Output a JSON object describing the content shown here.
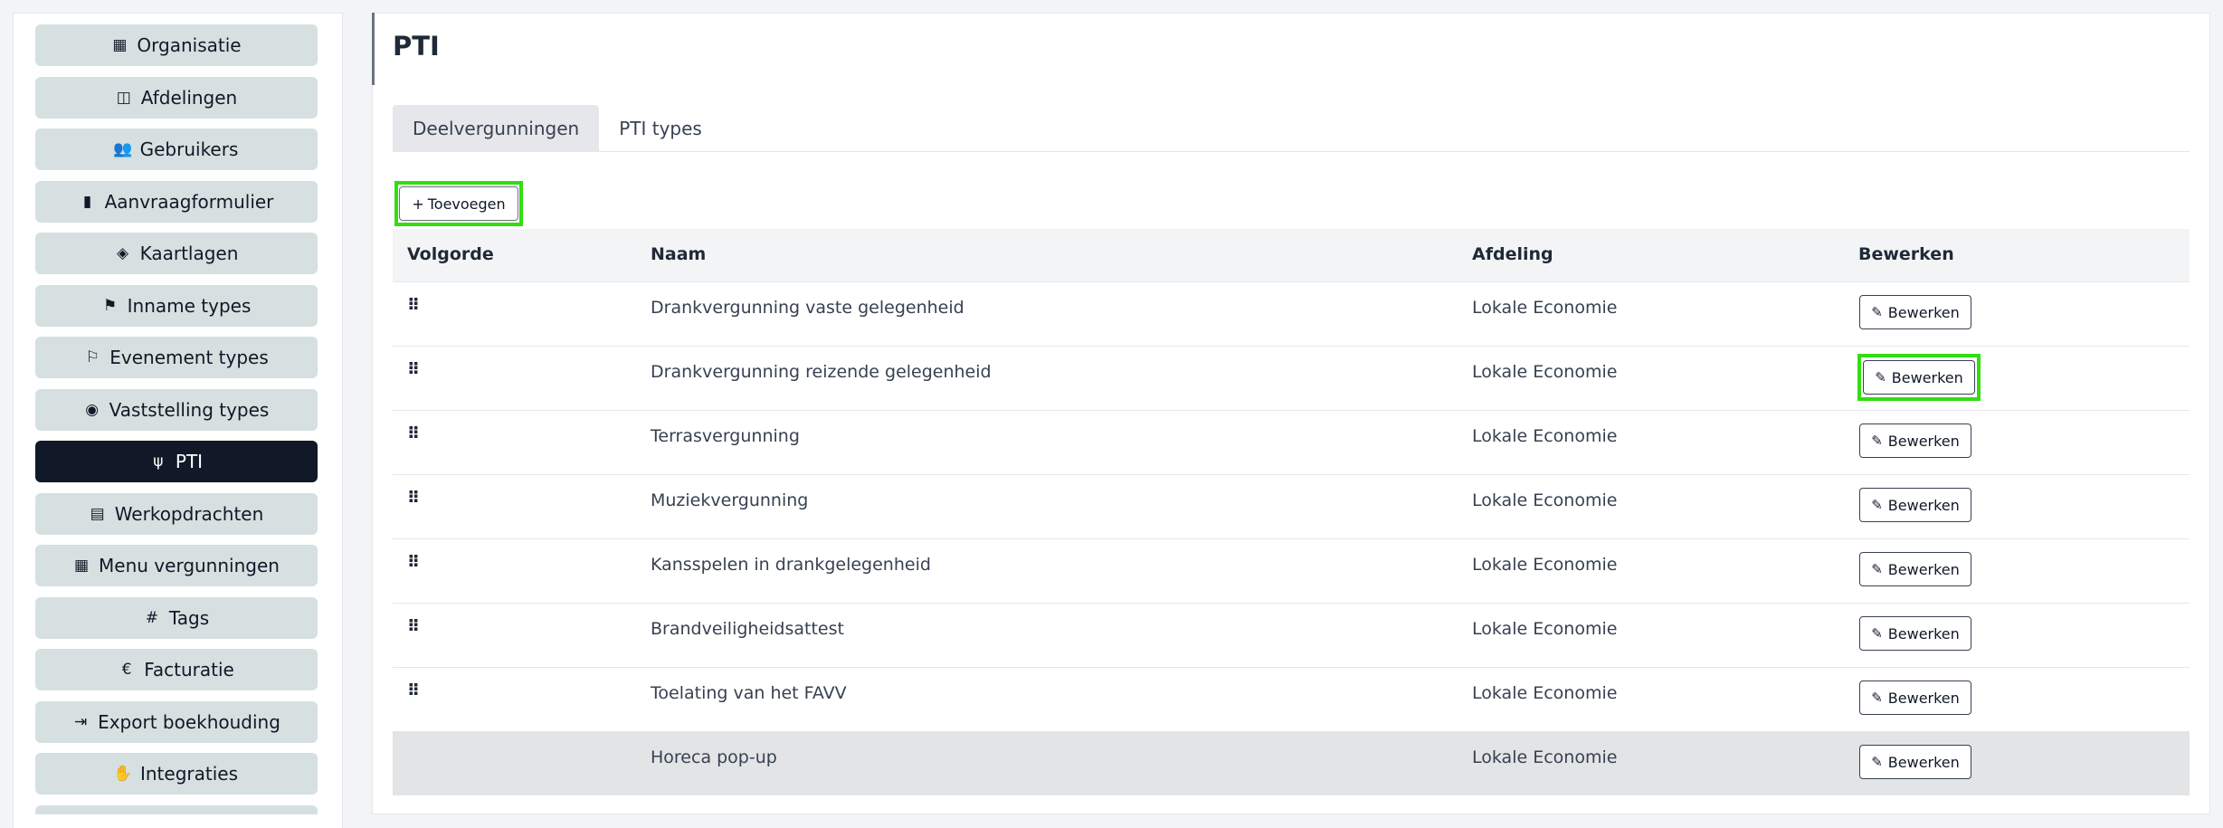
{
  "sidebar": {
    "items": [
      {
        "label": "Organisatie",
        "icon": "building-icon",
        "glyph": "▦",
        "active": false
      },
      {
        "label": "Afdelingen",
        "icon": "table-columns-icon",
        "glyph": "◫",
        "active": false
      },
      {
        "label": "Gebruikers",
        "icon": "users-icon",
        "glyph": "👥",
        "active": false
      },
      {
        "label": "Aanvraagformulier",
        "icon": "clipboard-icon",
        "glyph": "▮",
        "active": false
      },
      {
        "label": "Kaartlagen",
        "icon": "layers-icon",
        "glyph": "◈",
        "active": false
      },
      {
        "label": "Inname types",
        "icon": "signs-post-icon",
        "glyph": "⚑",
        "active": false
      },
      {
        "label": "Evenement types",
        "icon": "flag-checkered-icon",
        "glyph": "⚐",
        "active": false
      },
      {
        "label": "Vaststelling types",
        "icon": "eye-icon",
        "glyph": "◉",
        "active": false
      },
      {
        "label": "PTI",
        "icon": "utensils-icon",
        "glyph": "ψ",
        "active": true
      },
      {
        "label": "Werkopdrachten",
        "icon": "file-icon",
        "glyph": "▤",
        "active": false
      },
      {
        "label": "Menu vergunningen",
        "icon": "table-list-icon",
        "glyph": "▦",
        "active": false
      },
      {
        "label": "Tags",
        "icon": "hashtag-icon",
        "glyph": "#",
        "active": false
      },
      {
        "label": "Facturatie",
        "icon": "euro-icon",
        "glyph": "€",
        "active": false
      },
      {
        "label": "Export boekhouding",
        "icon": "file-export-icon",
        "glyph": "⇥",
        "active": false
      },
      {
        "label": "Integraties",
        "icon": "handshake-icon",
        "glyph": "✋",
        "active": false
      }
    ]
  },
  "page": {
    "title": "PTI"
  },
  "tabs": [
    {
      "label": "Deelvergunningen",
      "active": true
    },
    {
      "label": "PTI types",
      "active": false
    }
  ],
  "toolbar": {
    "add_label": "Toevoegen",
    "add_glyph": "+"
  },
  "table": {
    "headers": [
      "Volgorde",
      "Naam",
      "Afdeling",
      "Bewerken"
    ],
    "edit_label": "Bewerken",
    "rows": [
      {
        "naam": "Drankvergunning vaste gelegenheid",
        "afdeling": "Lokale Economie",
        "draggable": true,
        "highlight": false
      },
      {
        "naam": "Drankvergunning reizende gelegenheid",
        "afdeling": "Lokale Economie",
        "draggable": true,
        "highlight": true
      },
      {
        "naam": "Terrasvergunning",
        "afdeling": "Lokale Economie",
        "draggable": true,
        "highlight": false
      },
      {
        "naam": "Muziekvergunning",
        "afdeling": "Lokale Economie",
        "draggable": true,
        "highlight": false
      },
      {
        "naam": "Kansspelen in drankgelegenheid",
        "afdeling": "Lokale Economie",
        "draggable": true,
        "highlight": false
      },
      {
        "naam": "Brandveiligheidsattest",
        "afdeling": "Lokale Economie",
        "draggable": true,
        "highlight": false
      },
      {
        "naam": "Toelating van het FAVV",
        "afdeling": "Lokale Economie",
        "draggable": true,
        "highlight": false
      },
      {
        "naam": "Horeca pop-up",
        "afdeling": "Lokale Economie",
        "draggable": false,
        "highlight": false
      }
    ]
  },
  "colors": {
    "highlight": "#33dd11",
    "sidebar_item": "#d6e0e0",
    "sidebar_active": "#111827",
    "last_row": "#e2e4e6"
  }
}
